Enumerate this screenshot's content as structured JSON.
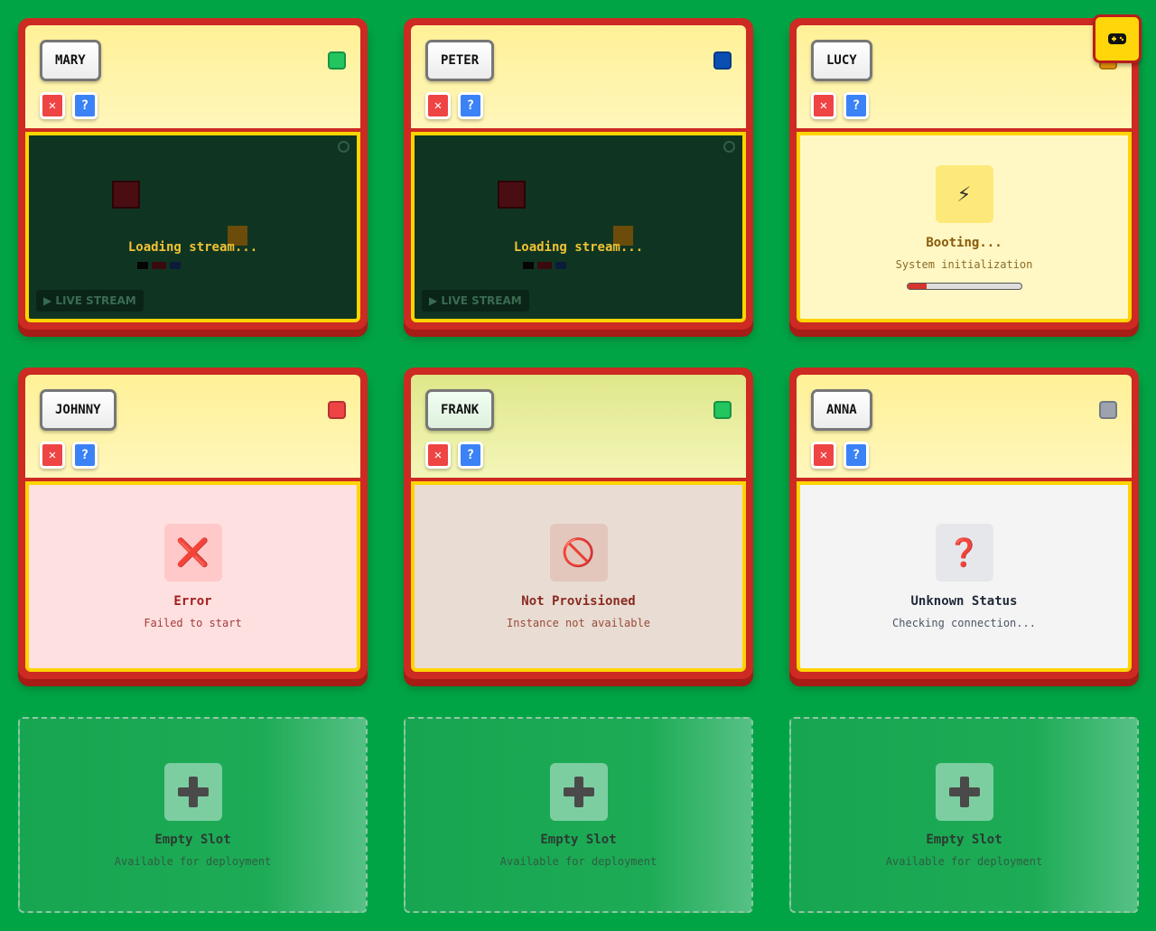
{
  "fab": {
    "icon": "gamepad-icon"
  },
  "cards": [
    {
      "name": "MARY",
      "status_color": "#22c55e",
      "close_label": "✕",
      "help_label": "?",
      "stream": {
        "loading_text": "Loading stream...",
        "live_label": "▶ LIVE STREAM"
      }
    },
    {
      "name": "PETER",
      "status_color": "#0b4fb3",
      "close_label": "✕",
      "help_label": "?",
      "stream": {
        "loading_text": "Loading stream...",
        "live_label": "▶ LIVE STREAM"
      }
    },
    {
      "name": "LUCY",
      "status_color": "#f59e0b",
      "close_label": "✕",
      "help_label": "?",
      "status": {
        "icon": "⚡",
        "icon_name": "lightning-icon",
        "title": "Booting...",
        "subtitle": "System initialization",
        "progress": 0.17
      }
    },
    {
      "name": "JOHNNY",
      "status_color": "#ef4444",
      "close_label": "✕",
      "help_label": "?",
      "status": {
        "icon": "❌",
        "icon_name": "error-x-icon",
        "title": "Error",
        "subtitle": "Failed to start"
      }
    },
    {
      "name": "FRANK",
      "status_color": "#22c55e",
      "close_label": "✕",
      "help_label": "?",
      "status": {
        "icon": "🚫",
        "icon_name": "prohibited-icon",
        "title": "Not Provisioned",
        "subtitle": "Instance not available"
      }
    },
    {
      "name": "ANNA",
      "status_color": "#9ca3af",
      "close_label": "✕",
      "help_label": "?",
      "status": {
        "icon": "❓",
        "icon_name": "question-icon",
        "title": "Unknown Status",
        "subtitle": "Checking connection..."
      }
    }
  ],
  "empty_slots": [
    {
      "icon": "plus-icon",
      "title": "Empty Slot",
      "subtitle": "Available for deployment"
    },
    {
      "icon": "plus-icon",
      "title": "Empty Slot",
      "subtitle": "Available for deployment"
    },
    {
      "icon": "plus-icon",
      "title": "Empty Slot",
      "subtitle": "Available for deployment"
    }
  ]
}
